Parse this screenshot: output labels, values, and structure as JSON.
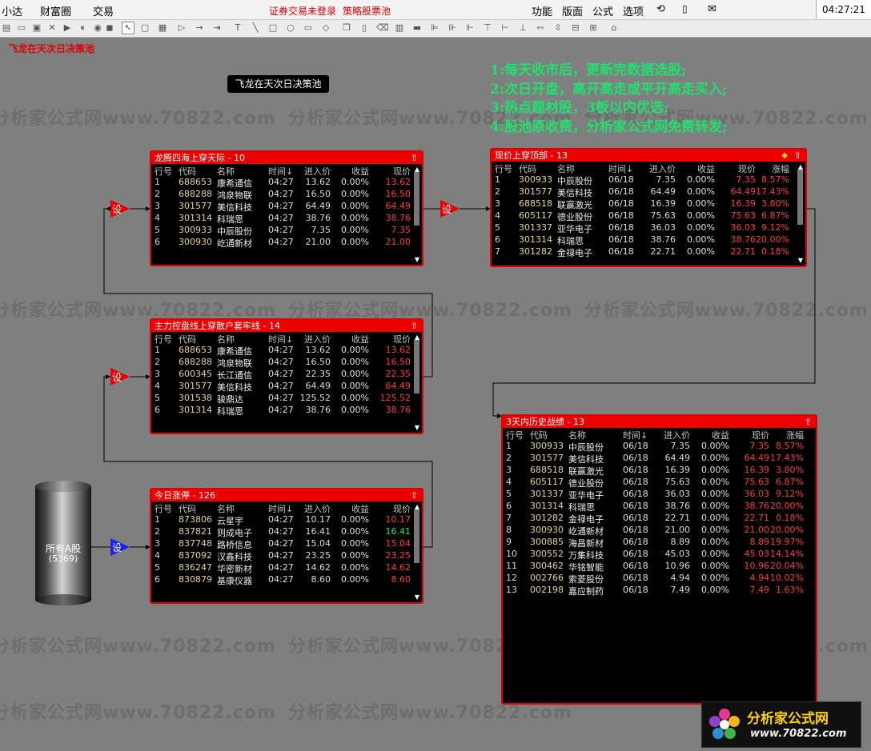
{
  "menubar": {
    "items": [
      "小达",
      "财富圈",
      "交易"
    ],
    "alert1": "证券交易未登录",
    "alert2": "策略股票池",
    "right_items": [
      "功能",
      "版面",
      "公式",
      "选项"
    ],
    "clock": "04:27:21 周"
  },
  "page": {
    "title": "飞龙在天次日决策池",
    "strategy_label": "飞龙在天次日决策池",
    "notes": [
      "1:每天收市后，更新完数据选股;",
      "2:次日开盘，高开高走或平开高走买入;",
      "3:热点题材股，3板以内优选;",
      "4:股池原收费，分析家公式网免费转发;"
    ],
    "watermark": "分析家公式网www.70822.com"
  },
  "source": {
    "name": "所有A股",
    "count": "(5369)"
  },
  "setter_label": "设",
  "columns": [
    "行号",
    "代码",
    "名称",
    "时间↓",
    "进入价",
    "收益",
    "现价"
  ],
  "columns_wide": [
    "行号",
    "代码",
    "名称",
    "时间↓",
    "进入价",
    "收益",
    "现价",
    "涨幅"
  ],
  "panels": {
    "p1": {
      "title": "龙腾四海上穿天际 - 10",
      "rows": [
        [
          "1",
          "688653",
          "康希通信",
          "04:27",
          "13.62",
          "0.00%",
          "13.62",
          "r"
        ],
        [
          "2",
          "688288",
          "鸿泉物联",
          "04:27",
          "16.50",
          "0.00%",
          "16.50",
          "r"
        ],
        [
          "3",
          "301577",
          "美信科技",
          "04:27",
          "64.49",
          "0.00%",
          "64.49",
          "r"
        ],
        [
          "4",
          "301314",
          "科瑞思",
          "04:27",
          "38.76",
          "0.00%",
          "38.76",
          "r"
        ],
        [
          "5",
          "300933",
          "中辰股份",
          "04:27",
          "7.35",
          "0.00%",
          "7.35",
          "r"
        ],
        [
          "6",
          "300930",
          "屹通新材",
          "04:27",
          "21.00",
          "0.00%",
          "21.00",
          "r"
        ]
      ]
    },
    "p2": {
      "title": "主力控盘线上穿散户套牢线 - 14",
      "rows": [
        [
          "1",
          "688653",
          "康希通信",
          "04:27",
          "13.62",
          "0.00%",
          "13.62",
          "r"
        ],
        [
          "2",
          "688288",
          "鸿泉物联",
          "04:27",
          "16.50",
          "0.00%",
          "16.50",
          "r"
        ],
        [
          "3",
          "600345",
          "长江通信",
          "04:27",
          "22.35",
          "0.00%",
          "22.35",
          "r"
        ],
        [
          "4",
          "301577",
          "美信科技",
          "04:27",
          "64.49",
          "0.00%",
          "64.49",
          "r"
        ],
        [
          "5",
          "301538",
          "骏鼎达",
          "04:27",
          "125.52",
          "0.00%",
          "125.52",
          "r"
        ],
        [
          "6",
          "301314",
          "科瑞思",
          "04:27",
          "38.76",
          "0.00%",
          "38.76",
          "r"
        ]
      ]
    },
    "p3": {
      "title": "今日涨停 - 126",
      "rows": [
        [
          "1",
          "873806",
          "云星宇",
          "04:27",
          "10.17",
          "0.00%",
          "10.17",
          "r"
        ],
        [
          "2",
          "837821",
          "则成电子",
          "04:27",
          "16.41",
          "0.00%",
          "16.41",
          "g"
        ],
        [
          "3",
          "837748",
          "路桥信息",
          "04:27",
          "15.04",
          "0.00%",
          "15.04",
          "r"
        ],
        [
          "4",
          "837092",
          "汉鑫科技",
          "04:27",
          "23.25",
          "0.00%",
          "23.25",
          "r"
        ],
        [
          "5",
          "836247",
          "华密新材",
          "04:27",
          "14.62",
          "0.00%",
          "14.62",
          "r"
        ],
        [
          "6",
          "830879",
          "基康仪器",
          "04:27",
          "8.60",
          "0.00%",
          "8.60",
          "r"
        ]
      ]
    },
    "p4": {
      "title": "现价上穿顶部 - 13",
      "rows": [
        [
          "1",
          "300933",
          "中辰股份",
          "06/18",
          "7.35",
          "0.00%",
          "7.35",
          "8.57%"
        ],
        [
          "2",
          "301577",
          "美信科技",
          "06/18",
          "64.49",
          "0.00%",
          "64.49",
          "17.43%"
        ],
        [
          "3",
          "688518",
          "联赢激光",
          "06/18",
          "16.39",
          "0.00%",
          "16.39",
          "3.80%"
        ],
        [
          "4",
          "605117",
          "德业股份",
          "06/18",
          "75.63",
          "0.00%",
          "75.63",
          "6.87%"
        ],
        [
          "5",
          "301337",
          "亚华电子",
          "06/18",
          "36.03",
          "0.00%",
          "36.03",
          "9.12%"
        ],
        [
          "6",
          "301314",
          "科瑞思",
          "06/18",
          "38.76",
          "0.00%",
          "38.76",
          "20.00%"
        ],
        [
          "7",
          "301282",
          "金禄电子",
          "06/18",
          "22.71",
          "0.00%",
          "22.71",
          "0.18%"
        ]
      ]
    },
    "p5": {
      "title": "3天内历史战绩 - 13",
      "rows": [
        [
          "1",
          "300933",
          "中辰股份",
          "06/18",
          "7.35",
          "0.00%",
          "7.35",
          "8.57%"
        ],
        [
          "2",
          "301577",
          "美信科技",
          "06/18",
          "64.49",
          "0.00%",
          "64.49",
          "17.43%"
        ],
        [
          "3",
          "688518",
          "联赢激光",
          "06/18",
          "16.39",
          "0.00%",
          "16.39",
          "3.80%"
        ],
        [
          "4",
          "605117",
          "德业股份",
          "06/18",
          "75.63",
          "0.00%",
          "75.63",
          "6.87%"
        ],
        [
          "5",
          "301337",
          "亚华电子",
          "06/18",
          "36.03",
          "0.00%",
          "36.03",
          "9.12%"
        ],
        [
          "6",
          "301314",
          "科瑞思",
          "06/18",
          "38.76",
          "0.00%",
          "38.76",
          "20.00%"
        ],
        [
          "7",
          "301282",
          "金禄电子",
          "06/18",
          "22.71",
          "0.00%",
          "22.71",
          "0.18%"
        ],
        [
          "8",
          "300930",
          "屹通新材",
          "06/18",
          "21.00",
          "0.00%",
          "21.00",
          "20.00%"
        ],
        [
          "9",
          "300885",
          "海昌新材",
          "06/18",
          "8.89",
          "0.00%",
          "8.89",
          "19.97%"
        ],
        [
          "10",
          "300552",
          "万集科技",
          "06/18",
          "45.03",
          "0.00%",
          "45.03",
          "14.14%"
        ],
        [
          "11",
          "300462",
          "华铭智能",
          "06/18",
          "10.96",
          "0.00%",
          "10.96",
          "20.04%"
        ],
        [
          "12",
          "002766",
          "索菱股份",
          "06/18",
          "4.94",
          "0.00%",
          "4.94",
          "10.02%"
        ],
        [
          "13",
          "002198",
          "嘉应制药",
          "06/18",
          "7.49",
          "0.00%",
          "7.49",
          "1.63%"
        ]
      ]
    }
  },
  "logo": {
    "line1": "分析家公式网",
    "line2": "www.70822.com"
  },
  "colors": {
    "accent_red": "#e00000",
    "up": "#ff3b3b",
    "flat_green": "#27e641",
    "notes_green": "#22e070"
  }
}
